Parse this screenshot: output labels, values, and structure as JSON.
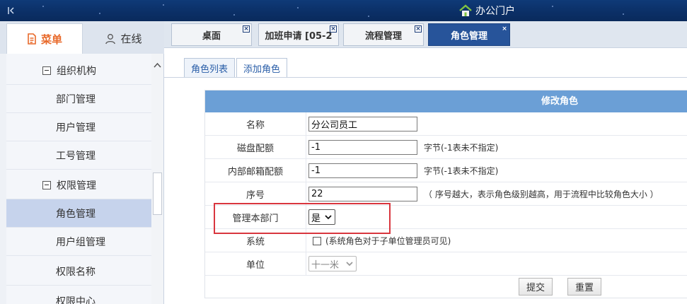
{
  "topbar": {
    "portal_label": "办公门户"
  },
  "sidebar": {
    "tabs": [
      {
        "label": "菜单",
        "icon": "document-icon"
      },
      {
        "label": "在线",
        "icon": "user-icon"
      }
    ],
    "tree": [
      {
        "type": "group",
        "label": "组织机构"
      },
      {
        "type": "leaf",
        "label": "部门管理"
      },
      {
        "type": "leaf",
        "label": "用户管理"
      },
      {
        "type": "leaf",
        "label": "工号管理"
      },
      {
        "type": "group",
        "label": "权限管理"
      },
      {
        "type": "leaf",
        "label": "角色管理",
        "active": true
      },
      {
        "type": "leaf",
        "label": "用户组管理"
      },
      {
        "type": "leaf",
        "label": "权限名称"
      },
      {
        "type": "leaf",
        "label": "权限中心"
      }
    ]
  },
  "tabs": [
    {
      "label": "桌面"
    },
    {
      "label": "加班申请 [05-2"
    },
    {
      "label": "流程管理"
    },
    {
      "label": "角色管理",
      "active": true
    }
  ],
  "subtabs": [
    {
      "label": "角色列表",
      "active": true
    },
    {
      "label": "添加角色"
    }
  ],
  "form": {
    "title": "修改角色",
    "name": {
      "label": "名称",
      "value": "分公司员工"
    },
    "disk_quota": {
      "label": "磁盘配额",
      "value": "-1",
      "note": "字节(-1表未不指定)"
    },
    "mail_quota": {
      "label": "内部邮箱配额",
      "value": "-1",
      "note": "字节(-1表未不指定)"
    },
    "order": {
      "label": "序号",
      "value": "22",
      "note": "（ 序号越大，表示角色级别越高，用于流程中比较角色大小 ）"
    },
    "manage_dept": {
      "label": "管理本部门",
      "value": "是"
    },
    "system": {
      "label": "系统",
      "note": "(系统角色对于子单位管理员可见)"
    },
    "unit": {
      "label": "单位",
      "value": "十一米"
    },
    "submit_label": "提交",
    "reset_label": "重置"
  },
  "colors": {
    "header_blue": "#0b2f66",
    "active_tab": "#27549a",
    "form_header": "#6b9fd6",
    "menu_orange": "#e8692a",
    "highlight_red": "#d9363e"
  }
}
